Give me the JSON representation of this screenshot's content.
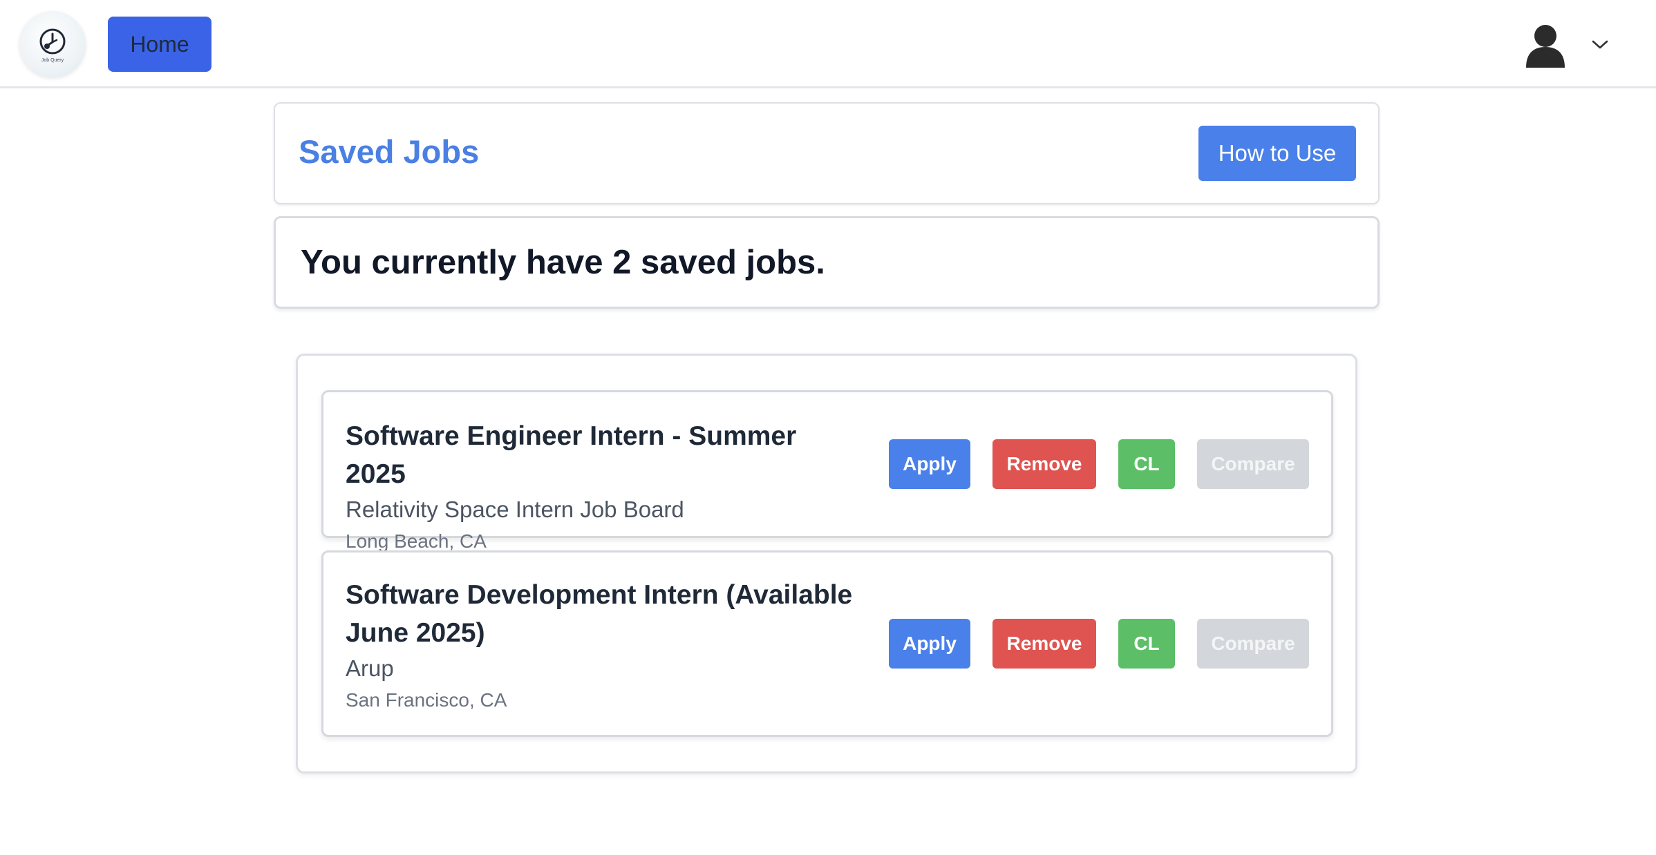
{
  "navbar": {
    "logo_text": "Job Query",
    "home_label": "Home"
  },
  "header": {
    "title": "Saved Jobs",
    "how_to_use_label": "How to Use"
  },
  "summary": {
    "text": "You currently have 2 saved jobs."
  },
  "jobs": [
    {
      "title": "Software Engineer Intern - Summer 2025",
      "company": "Relativity Space Intern Job Board",
      "location": "Long Beach, CA",
      "apply_label": "Apply",
      "remove_label": "Remove",
      "cl_label": "CL",
      "compare_label": "Compare"
    },
    {
      "title": "Software Development Intern (Available June 2025)",
      "company": "Arup",
      "location": "San Francisco, CA",
      "apply_label": "Apply",
      "remove_label": "Remove",
      "cl_label": "CL",
      "compare_label": "Compare"
    }
  ],
  "colors": {
    "primary": "#4a80ea",
    "home_button": "#3a63e8",
    "danger": "#df5350",
    "success": "#5cbf68",
    "disabled": "#d3d6da",
    "title_blue": "#4a7fe4"
  },
  "icons": {
    "logo": "clock-music-logo-icon",
    "avatar": "user-avatar-icon",
    "dropdown": "chevron-down-icon"
  }
}
